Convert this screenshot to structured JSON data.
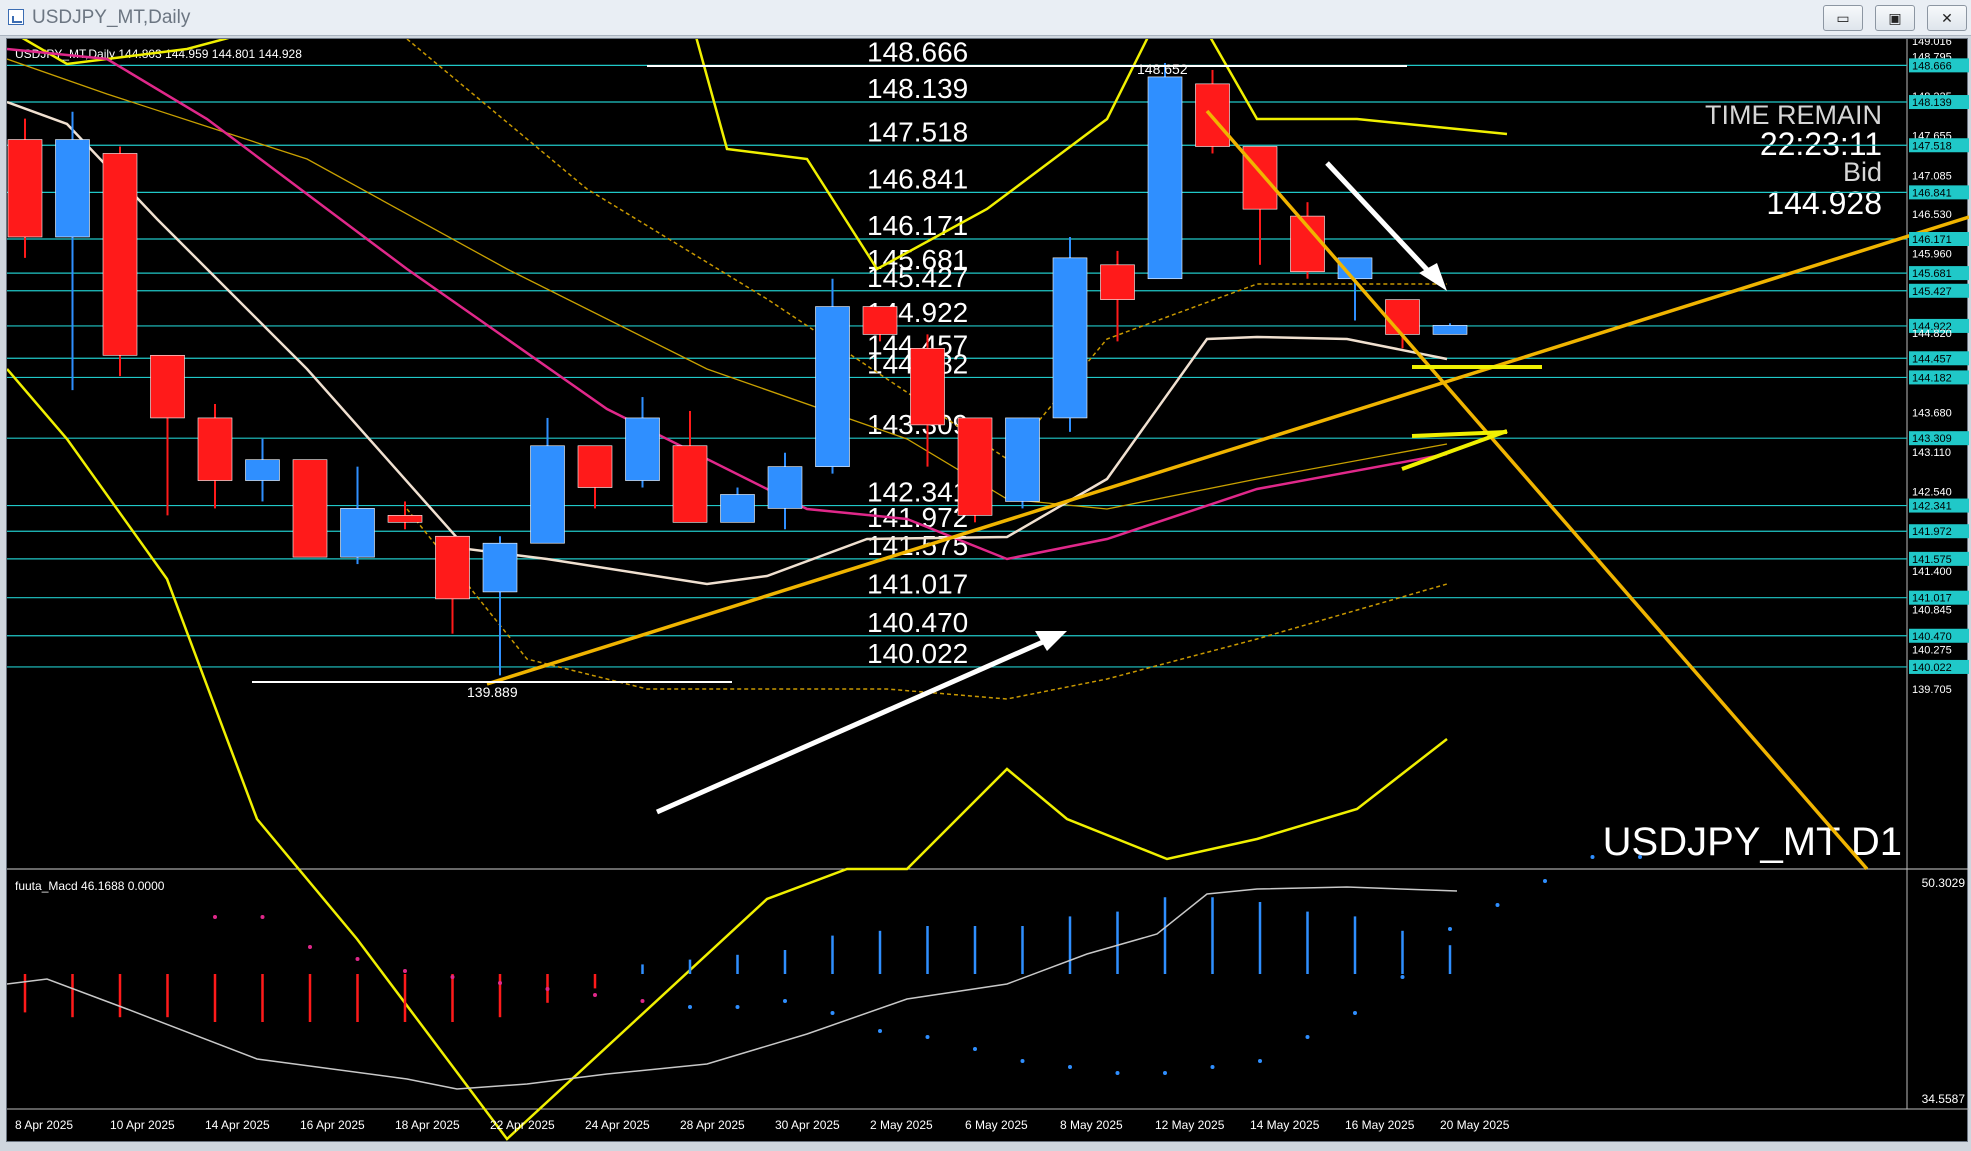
{
  "window": {
    "title": "USDJPY_MT,Daily",
    "buttons": {
      "minimize": "▭",
      "restore": "▣",
      "close": "✕"
    }
  },
  "colors": {
    "background": "#000000",
    "bull_candle": "#2f8fff",
    "bear_candle": "#ff1a1a",
    "level_line": "#20c8c8",
    "trendline": "#f0b400",
    "band": "#f0f000",
    "ma_fast": "#f0e0d0",
    "ma_slow": "#e0288a",
    "arrow": "#ffffff",
    "text": "#ffffff"
  },
  "chart": {
    "header": "USDJPY_MT,Daily  144.803 144.959 144.801 144.928",
    "symbol_label": "USDJPY_MT D1",
    "time_remain_label": "TIME REMAIN",
    "time_remain_value": "22:23:11",
    "bid_label": "Bid",
    "bid_value": "144.928",
    "high_marker": "148.652",
    "low_marker": "139.889"
  },
  "macd": {
    "header": "fuuta_Macd 46.1688  0.0000",
    "axis_top": "50.3029",
    "axis_bottom": "34.5587"
  },
  "chart_data": {
    "type": "candlestick",
    "title": "USDJPY_MT,Daily",
    "price_axis_labels": [
      "149.016",
      "148.795",
      "148.666",
      "148.225",
      "148.139",
      "147.655",
      "147.518",
      "147.085",
      "146.841",
      "146.530",
      "146.171",
      "145.960",
      "145.681",
      "145.427",
      "144.922",
      "144.820",
      "144.457",
      "144.182",
      "143.680",
      "143.309",
      "143.110",
      "142.540",
      "142.341",
      "141.972",
      "141.575",
      "141.400",
      "141.017",
      "140.845",
      "140.470",
      "140.275",
      "140.022",
      "139.705"
    ],
    "levels": [
      148.666,
      148.139,
      147.518,
      146.841,
      146.171,
      145.681,
      145.427,
      144.922,
      144.457,
      144.182,
      143.309,
      142.341,
      141.972,
      141.575,
      141.017,
      140.47,
      140.022
    ],
    "date_labels": [
      "8 Apr 2025",
      "10 Apr 2025",
      "14 Apr 2025",
      "16 Apr 2025",
      "18 Apr 2025",
      "22 Apr 2025",
      "24 Apr 2025",
      "28 Apr 2025",
      "30 Apr 2025",
      "2 May 2025",
      "6 May 2025",
      "8 May 2025",
      "12 May 2025",
      "14 May 2025",
      "16 May 2025",
      "20 May 2025"
    ],
    "candles": [
      {
        "o": 147.6,
        "h": 147.9,
        "l": 145.9,
        "c": 146.2
      },
      {
        "o": 146.2,
        "h": 148.0,
        "l": 144.0,
        "c": 147.6
      },
      {
        "o": 147.4,
        "h": 147.5,
        "l": 144.2,
        "c": 144.5
      },
      {
        "o": 144.5,
        "h": 144.5,
        "l": 142.2,
        "c": 143.6
      },
      {
        "o": 143.6,
        "h": 143.8,
        "l": 142.3,
        "c": 142.7
      },
      {
        "o": 142.7,
        "h": 143.3,
        "l": 142.4,
        "c": 143.0
      },
      {
        "o": 143.0,
        "h": 143.0,
        "l": 141.7,
        "c": 141.6
      },
      {
        "o": 141.6,
        "h": 142.9,
        "l": 141.5,
        "c": 142.3
      },
      {
        "o": 142.2,
        "h": 142.4,
        "l": 142.0,
        "c": 142.1
      },
      {
        "o": 141.9,
        "h": 141.9,
        "l": 140.5,
        "c": 141.0
      },
      {
        "o": 141.1,
        "h": 141.9,
        "l": 139.9,
        "c": 141.8
      },
      {
        "o": 141.8,
        "h": 143.6,
        "l": 141.8,
        "c": 143.2
      },
      {
        "o": 143.2,
        "h": 143.2,
        "l": 142.3,
        "c": 142.6
      },
      {
        "o": 142.7,
        "h": 143.9,
        "l": 142.6,
        "c": 143.6
      },
      {
        "o": 143.2,
        "h": 143.7,
        "l": 142.1,
        "c": 142.1
      },
      {
        "o": 142.1,
        "h": 142.6,
        "l": 142.1,
        "c": 142.5
      },
      {
        "o": 142.3,
        "h": 143.1,
        "l": 142.0,
        "c": 142.9
      },
      {
        "o": 142.9,
        "h": 145.6,
        "l": 142.8,
        "c": 145.2
      },
      {
        "o": 145.2,
        "h": 145.2,
        "l": 144.7,
        "c": 144.8
      },
      {
        "o": 144.6,
        "h": 144.8,
        "l": 142.9,
        "c": 143.5
      },
      {
        "o": 143.6,
        "h": 143.6,
        "l": 142.1,
        "c": 142.2
      },
      {
        "o": 142.4,
        "h": 143.6,
        "l": 142.3,
        "c": 143.6
      },
      {
        "o": 143.6,
        "h": 146.2,
        "l": 143.4,
        "c": 145.9
      },
      {
        "o": 145.8,
        "h": 146.0,
        "l": 144.7,
        "c": 145.3
      },
      {
        "o": 145.6,
        "h": 148.7,
        "l": 145.6,
        "c": 148.5
      },
      {
        "o": 148.4,
        "h": 148.6,
        "l": 147.4,
        "c": 147.5
      },
      {
        "o": 147.5,
        "h": 147.5,
        "l": 145.8,
        "c": 146.6
      },
      {
        "o": 146.5,
        "h": 146.7,
        "l": 145.6,
        "c": 145.7
      },
      {
        "o": 145.6,
        "h": 145.9,
        "l": 145.0,
        "c": 145.9
      },
      {
        "o": 145.3,
        "h": 145.3,
        "l": 144.6,
        "c": 144.8
      },
      {
        "o": 144.8,
        "h": 144.96,
        "l": 144.8,
        "c": 144.93
      }
    ]
  }
}
